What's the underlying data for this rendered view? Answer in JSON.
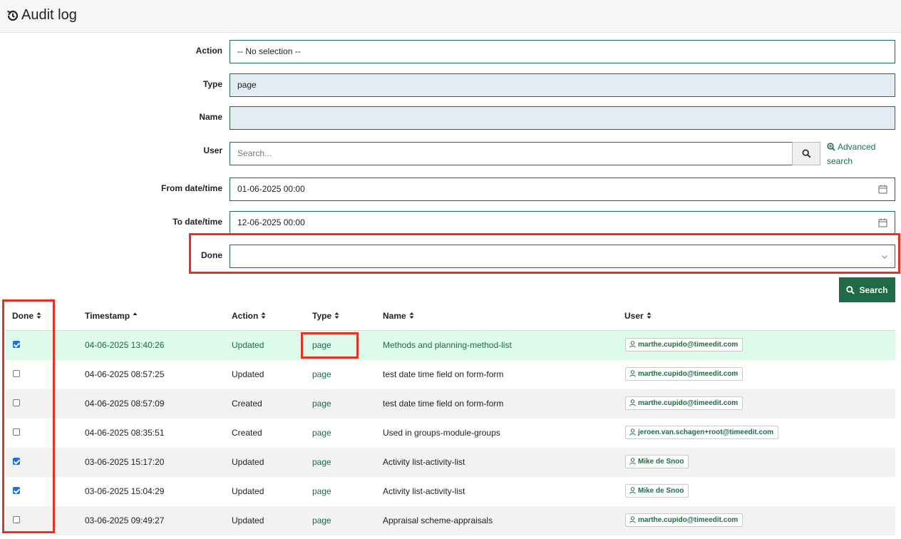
{
  "header": {
    "title": "Audit log",
    "icon": "history-icon"
  },
  "form": {
    "action": {
      "label": "Action",
      "value": "-- No selection --"
    },
    "type": {
      "label": "Type",
      "value": "page"
    },
    "name": {
      "label": "Name",
      "value": ""
    },
    "user": {
      "label": "User",
      "placeholder": "Search...",
      "advanced_search": "Advanced search"
    },
    "from": {
      "label": "From date/time",
      "value": "01-06-2025 00:00"
    },
    "to": {
      "label": "To date/time",
      "value": "12-06-2025 00:00"
    },
    "done": {
      "label": "Done",
      "value": ""
    },
    "search_button": "Search"
  },
  "table": {
    "columns": [
      "Done",
      "Timestamp",
      "Action",
      "Type",
      "Name",
      "User"
    ],
    "rows": [
      {
        "done": true,
        "timestamp": "04-06-2025 13:40:26",
        "action": "Updated",
        "type": "page",
        "name": "Methods and planning-method-list",
        "user": "marthe.cupido@timeedit.com"
      },
      {
        "done": false,
        "timestamp": "04-06-2025 08:57:25",
        "action": "Updated",
        "type": "page",
        "name": "test date time field on form-form",
        "user": "marthe.cupido@timeedit.com"
      },
      {
        "done": false,
        "timestamp": "04-06-2025 08:57:09",
        "action": "Created",
        "type": "page",
        "name": "test date time field on form-form",
        "user": "marthe.cupido@timeedit.com"
      },
      {
        "done": false,
        "timestamp": "04-06-2025 08:35:51",
        "action": "Created",
        "type": "page",
        "name": "Used in groups-module-groups",
        "user": "jeroen.van.schagen+root@timeedit.com"
      },
      {
        "done": true,
        "timestamp": "03-06-2025 15:17:20",
        "action": "Updated",
        "type": "page",
        "name": "Activity list-activity-list",
        "user": "Mike de Snoo"
      },
      {
        "done": true,
        "timestamp": "03-06-2025 15:04:29",
        "action": "Updated",
        "type": "page",
        "name": "Activity list-activity-list",
        "user": "Mike de Snoo"
      },
      {
        "done": false,
        "timestamp": "03-06-2025 09:49:27",
        "action": "Updated",
        "type": "page",
        "name": "Appraisal scheme-appraisals",
        "user": "marthe.cupido@timeedit.com"
      }
    ]
  },
  "colors": {
    "accent": "#1f6b45",
    "selected_row": "#dcfbea",
    "highlight": "#e53323",
    "checkbox": "#1b6ee5"
  }
}
